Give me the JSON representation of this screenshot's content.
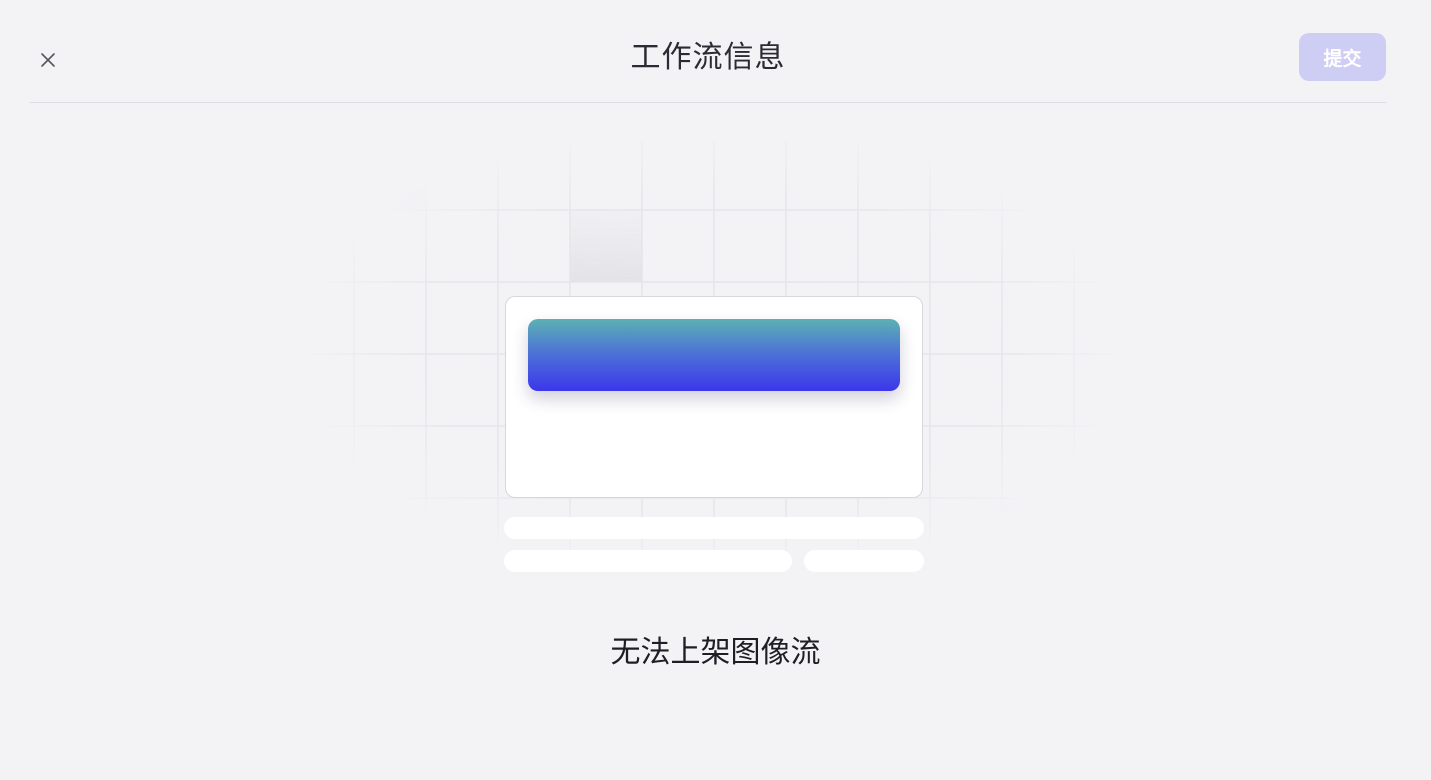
{
  "header": {
    "title": "工作流信息",
    "submit_label": "提交"
  },
  "empty_state": {
    "message": "无法上架图像流"
  },
  "icons": {
    "close": "close-icon"
  },
  "colors": {
    "submit_bg": "#cecdf4",
    "gradient_top": "#5cb1b2",
    "gradient_bottom": "#3d36ea",
    "page_bg": "#f3f3f6"
  }
}
